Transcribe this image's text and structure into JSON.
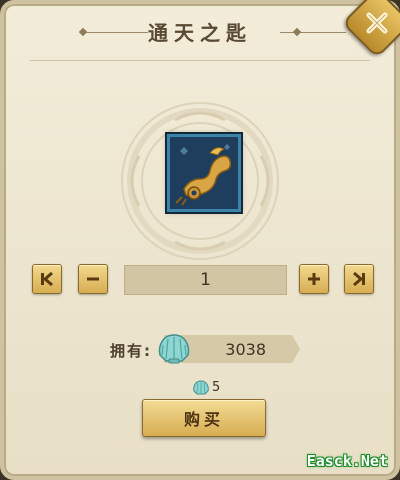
{
  "dialog": {
    "title": "通天之匙",
    "close_icon": "close-x-icon",
    "item": {
      "icon": "golden-key-icon"
    },
    "quantity": {
      "value": "1",
      "min_icon": "first-icon",
      "dec_icon": "minus-icon",
      "inc_icon": "plus-icon",
      "max_icon": "last-icon"
    },
    "owned": {
      "label": "拥有:",
      "value": "3038",
      "currency_icon": "shell-icon"
    },
    "price": {
      "value": "5",
      "currency_icon": "shell-icon"
    },
    "buy_label": "购买",
    "colors": {
      "gold": "#d6ad52",
      "panel": "#ece4cf",
      "frame": "#1f3e5e"
    }
  },
  "watermark": "Easck.Net"
}
